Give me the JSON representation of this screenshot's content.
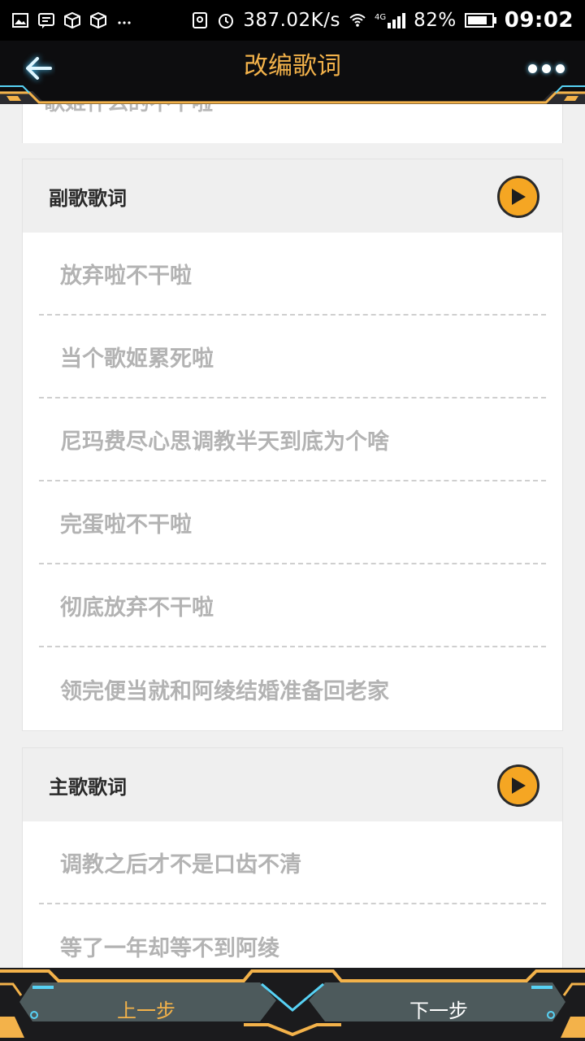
{
  "status": {
    "speed": "387.02K/s",
    "network": "4G",
    "battery": "82%",
    "time": "09:02"
  },
  "header": {
    "title": "改编歌词",
    "accent_color": "#f3b24a"
  },
  "previous_section": {
    "partial_line": "歌姬什么的不干啦"
  },
  "sections": [
    {
      "label": "副歌歌词",
      "lines": [
        "放弃啦不干啦",
        "当个歌姬累死啦",
        "尼玛费尽心思调教半天到底为个啥",
        "完蛋啦不干啦",
        "彻底放弃不干啦",
        "领完便当就和阿绫结婚准备回老家"
      ]
    },
    {
      "label": "主歌歌词",
      "lines": [
        "调教之后才不是口齿不清",
        "等了一年却等不到阿绫"
      ]
    }
  ],
  "footer": {
    "prev_label": "上一步",
    "next_label": "下一步"
  },
  "icons": {
    "back": "arrow-left-icon",
    "more": "more-dots-icon",
    "play": "play-icon"
  }
}
